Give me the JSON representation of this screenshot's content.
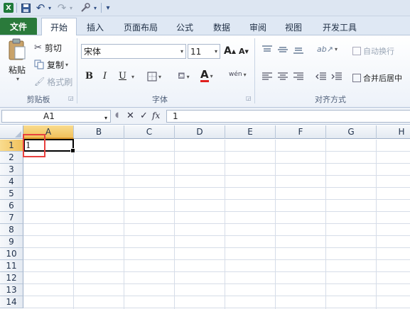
{
  "quick_access": {
    "logo": "X",
    "undo": "↶",
    "redo": "↷",
    "customize": "▾"
  },
  "tabs": [
    {
      "label": "文件"
    },
    {
      "label": "开始"
    },
    {
      "label": "插入"
    },
    {
      "label": "页面布局"
    },
    {
      "label": "公式"
    },
    {
      "label": "数据"
    },
    {
      "label": "审阅"
    },
    {
      "label": "视图"
    },
    {
      "label": "开发工具"
    }
  ],
  "clipboard": {
    "paste": "粘贴",
    "cut": "剪切",
    "copy": "复制",
    "format_painter": "格式刷",
    "group_label": "剪贴板"
  },
  "font": {
    "name": "宋体",
    "size": "11",
    "grow": "A",
    "shrink": "A",
    "bold": "B",
    "italic": "I",
    "underline": "U",
    "font_color": "A",
    "phonetic": "wén",
    "group_label": "字体"
  },
  "alignment": {
    "wrap_text": "自动换行",
    "merge_center": "合并后居中",
    "group_label": "对齐方式"
  },
  "formula_bar": {
    "name_box": "A1",
    "cancel": "✕",
    "enter": "✓",
    "fx": "fx",
    "value": "1"
  },
  "columns": [
    "A",
    "B",
    "C",
    "D",
    "E",
    "F",
    "G",
    "H"
  ],
  "rows": [
    "1",
    "2",
    "3",
    "4",
    "5",
    "6",
    "7",
    "8",
    "9",
    "10",
    "11",
    "12",
    "13",
    "14"
  ],
  "active_cell": {
    "ref": "A1",
    "value": "1"
  },
  "colors": {
    "file_tab": "#2a7a3b",
    "selected_header": "#f1c15b",
    "highlight_box": "#e8403e"
  }
}
